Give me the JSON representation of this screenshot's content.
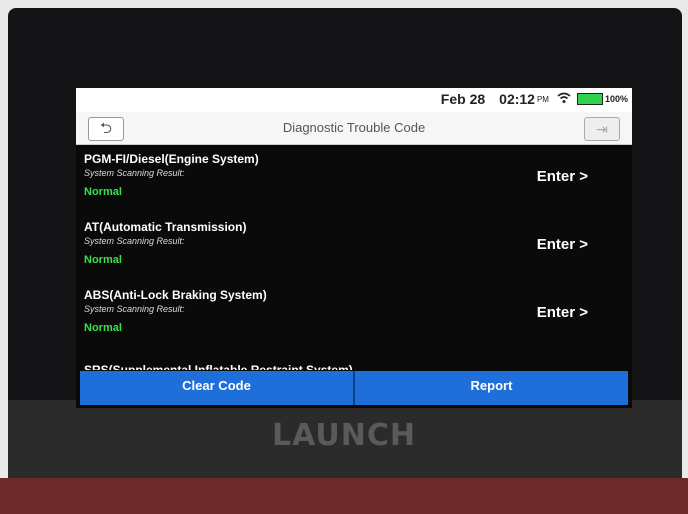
{
  "device": {
    "brand": "LAUNCH"
  },
  "status_bar": {
    "date": "Feb 28",
    "time": "02:12",
    "ampm": "PM",
    "battery": "100%",
    "battery_color": "#2fd14a"
  },
  "header": {
    "title": "Diagnostic Trouble Code",
    "back_icon": "back-arrow-icon",
    "exit_icon": "exit-icon"
  },
  "systems": [
    {
      "name": "PGM-FI/Diesel(Engine System)",
      "result_label": "System Scanning Result:",
      "status": "Normal",
      "action": "Enter >"
    },
    {
      "name": "AT(Automatic Transmission)",
      "result_label": "System Scanning Result:",
      "status": "Normal",
      "action": "Enter >"
    },
    {
      "name": "ABS(Anti-Lock Braking System)",
      "result_label": "System Scanning Result:",
      "status": "Normal",
      "action": "Enter >"
    }
  ],
  "partial_item": "SRS(Supplemental Inflatable Restraint System)",
  "footer": {
    "clear_label": "Clear Code",
    "report_label": "Report",
    "accent": "#1e6fd9"
  }
}
